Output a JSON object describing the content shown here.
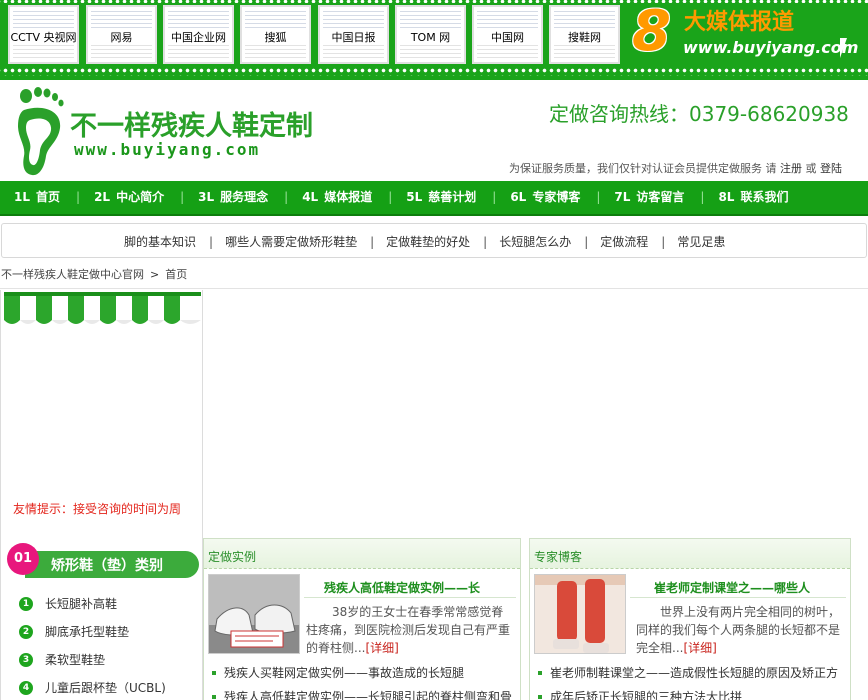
{
  "media_strip": {
    "thumbnails": [
      "CCTV 央视网",
      "网易",
      "中国企业网",
      "搜狐",
      "中国日报",
      "TOM 网",
      "中国网",
      "搜鞋网"
    ],
    "badge_number": "8",
    "badge_title": "大媒体报道",
    "badge_url": "www.buyiyang.com"
  },
  "header": {
    "brand": "不一样残疾人鞋定制",
    "url": "www.buyiyang.com",
    "hotline": "定做咨询热线：0379-68620938",
    "notice_prefix": "为保证服务质量，我们仅针对认证会员提供定做服务 请",
    "register": "注册",
    "or": "或",
    "login": "登陆"
  },
  "mainnav": [
    {
      "num": "1L",
      "label": "首页"
    },
    {
      "num": "2L",
      "label": "中心简介"
    },
    {
      "num": "3L",
      "label": "服务理念"
    },
    {
      "num": "4L",
      "label": "媒体报道"
    },
    {
      "num": "5L",
      "label": "慈善计划"
    },
    {
      "num": "6L",
      "label": "专家博客"
    },
    {
      "num": "7L",
      "label": "访客留言"
    },
    {
      "num": "8L",
      "label": "联系我们"
    }
  ],
  "subnav": [
    "脚的基本知识",
    "哪些人需要定做矫形鞋垫",
    "定做鞋垫的好处",
    "长短腿怎么办",
    "定做流程",
    "常见足患"
  ],
  "breadcrumb": {
    "site": "不一样残疾人鞋定做中心官网",
    "sep": ">",
    "current": "首页"
  },
  "sidebar": {
    "tip": "友情提示：接受咨询的时间为周",
    "category_num": "01",
    "category_title": "矫形鞋（垫）类别",
    "categories": [
      {
        "idx": "1",
        "label": "长短腿补高鞋"
      },
      {
        "idx": "2",
        "label": "脚底承托型鞋垫"
      },
      {
        "idx": "3",
        "label": "柔软型鞋垫"
      },
      {
        "idx": "4",
        "label": "儿童后跟杯垫（UCBL)"
      }
    ]
  },
  "cases": {
    "heading": "定做实例",
    "feature_title": "残疾人高低鞋定做实例——长",
    "summary": "38岁的王女士在春季常常感觉脊柱疼痛，到医院检测后发现自己有严重的脊柱侧...",
    "more": "[详细]",
    "items": [
      "残疾人买鞋网定做实例——事故造成的长短腿",
      "残疾人高低鞋定做实例——长短腿引起的脊柱侧弯和骨"
    ]
  },
  "blog": {
    "heading": "专家博客",
    "feature_title": "崔老师定制课堂之——哪些人",
    "summary": "世界上没有两片完全相同的树叶，同样的我们每个人两条腿的长短都不是完全相...",
    "more": "[详细]",
    "items": [
      "崔老师制鞋课堂之——造成假性长短腿的原因及矫正方",
      "成年后矫正长短腿的三种方法大比拼"
    ]
  }
}
